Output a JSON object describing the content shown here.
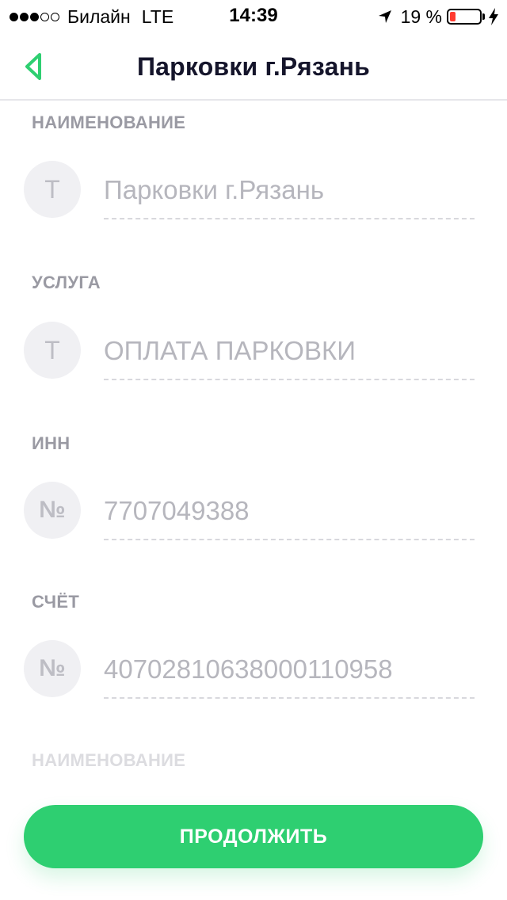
{
  "status_bar": {
    "carrier": "Билайн",
    "network": "LTE",
    "time": "14:39",
    "battery": "19 %",
    "battery_level": 0.19,
    "signal_bars_filled": 3,
    "signal_bars_total": 5
  },
  "nav": {
    "title": "Парковки г.Рязань",
    "back_icon": "chevron-left-icon",
    "accent_color": "#2ecf71"
  },
  "fields": [
    {
      "label": "НАИМЕНОВАНИЕ",
      "icon": "Т",
      "icon_name": "text-icon",
      "value": "Парковки г.Рязань"
    },
    {
      "label": "УСЛУГА",
      "icon": "Т",
      "icon_name": "text-icon",
      "value": "ОПЛАТА ПАРКОВКИ"
    },
    {
      "label": "ИНН",
      "icon": "№",
      "icon_name": "number-icon",
      "value": "7707049388"
    },
    {
      "label": "СЧЁТ",
      "icon": "№",
      "icon_name": "number-icon",
      "value": "40702810638000110958"
    }
  ],
  "next_field_label": "НАИМЕНОВАНИЕ",
  "continue_button": {
    "label": "ПРОДОЛЖИТЬ",
    "color": "#2ecf71"
  }
}
